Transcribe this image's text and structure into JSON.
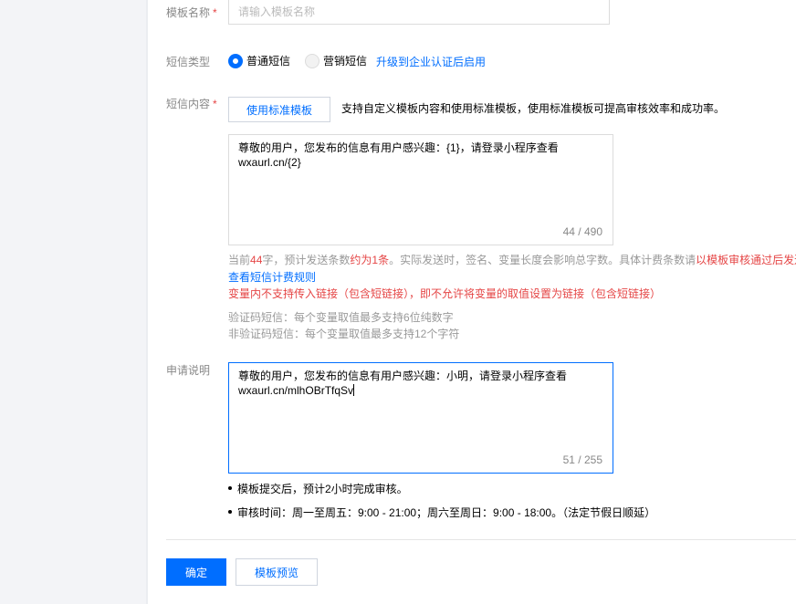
{
  "form": {
    "name": {
      "label": "模板名称",
      "required_mark": "*",
      "placeholder": "请输入模板名称"
    },
    "sms_type": {
      "label": "短信类型",
      "options": [
        {
          "label": "普通短信",
          "checked": true
        },
        {
          "label": "营销短信",
          "checked": false,
          "disabled": true
        }
      ],
      "upgrade_link": "升级到企业认证后启用"
    },
    "content": {
      "label": "短信内容",
      "required_mark": "*",
      "use_template_button": "使用标准模板",
      "tip": "支持自定义模板内容和使用标准模板，使用标准模板可提高审核效率和成功率。",
      "lines": [
        "尊敬的用户，您发布的信息有用户感兴趣：{1}，请登录小程序查看",
        "wxaurl.cn/{2}"
      ],
      "counter": "44 / 490"
    },
    "count_info": {
      "prefix": "当前",
      "chars": "44",
      "mid": "字，预计发送条数",
      "estimate": "约为1条",
      "suffix": "。实际发送时，签名、变量长度会影响总字数。具体计费条数请",
      "red_tail": "以模板审核通过后发送"
    },
    "billing_link": "查看短信计费规则",
    "link_warning": "变量内不支持传入链接（包含短链接），即不允许将变量的取值设置为链接（包含短链接）",
    "code_rule": "验证码短信：每个变量取值最多支持6位纯数字",
    "noncode_rule": "非验证码短信：每个变量取值最多支持12个字符",
    "apply": {
      "label": "申请说明",
      "lines": [
        "尊敬的用户，您发布的信息有用户感兴趣：小明，请登录小程序查看",
        "wxaurl.cn/mlhOBrTfqSv"
      ],
      "counter": "51 / 255"
    },
    "notes": [
      "模板提交后，预计2小时完成审核。",
      "审核时间：周一至周五：9:00 - 21:00；周六至周日：9:00 - 18:00。（法定节假日顺延）"
    ]
  },
  "actions": {
    "confirm": "确定",
    "preview": "模板预览"
  },
  "colors": {
    "primary": "#006eff",
    "danger": "#e54545",
    "muted": "#888888"
  }
}
